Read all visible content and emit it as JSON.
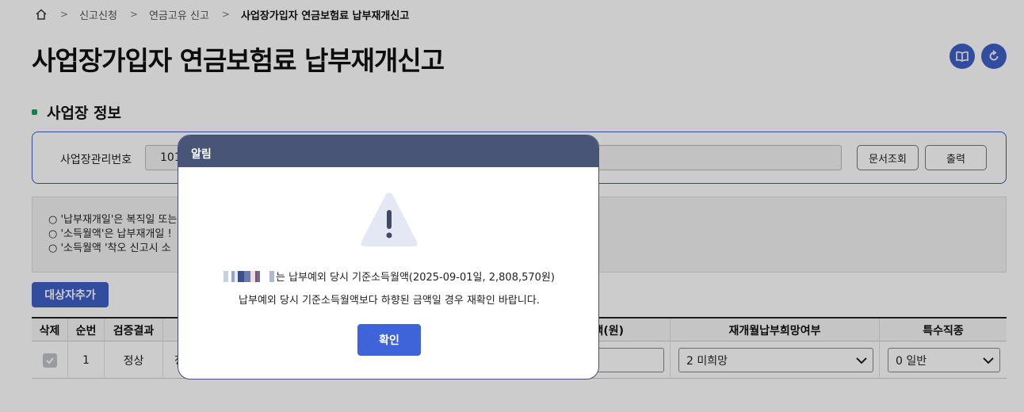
{
  "breadcrumb": {
    "items": [
      "신고신청",
      "연금고유 신고"
    ],
    "current": "사업장가입자 연금보험료 납부재개신고"
  },
  "page": {
    "title": "사업장가입자 연금보험료 납부재개신고"
  },
  "section": {
    "title": "사업장 정보"
  },
  "info": {
    "label": "사업장관리번호",
    "value": "101",
    "doc_lookup_label": "문서조회",
    "print_label": "출력"
  },
  "notice": {
    "lines": [
      "○ '납부재개일'은 복직일 또는",
      "○ '소득월액'은 납부재개일 !",
      "○ '소득월액 '착오 신고시 소"
    ]
  },
  "actions": {
    "add_target_label": "대상자추가"
  },
  "grid": {
    "headers": {
      "delete": "삭제",
      "seq": "순번",
      "result": "검증결과",
      "amount": "액(원)",
      "resume_hope": "재개월납부희망여부",
      "special_job": "특수직종"
    },
    "row": {
      "seq": "1",
      "result": "정상",
      "cut_text": "정",
      "resume_hope": "2 미희망",
      "special_job": "0 일반"
    }
  },
  "modal": {
    "title": "알림",
    "message_line1": "는 납부예외 당시 기준소득월액(2025-09-01일, 2,808,570원)",
    "message_line2": "납부예외 당시 기준소득월액보다 하향된 금액일 경우 재확인 바랍니다.",
    "confirm_label": "확인"
  },
  "colors": {
    "primary": "#3f5fc6",
    "modal_header": "#485577",
    "warning_triangle": "#e4e8f5",
    "section_dot": "#1aa35a"
  }
}
